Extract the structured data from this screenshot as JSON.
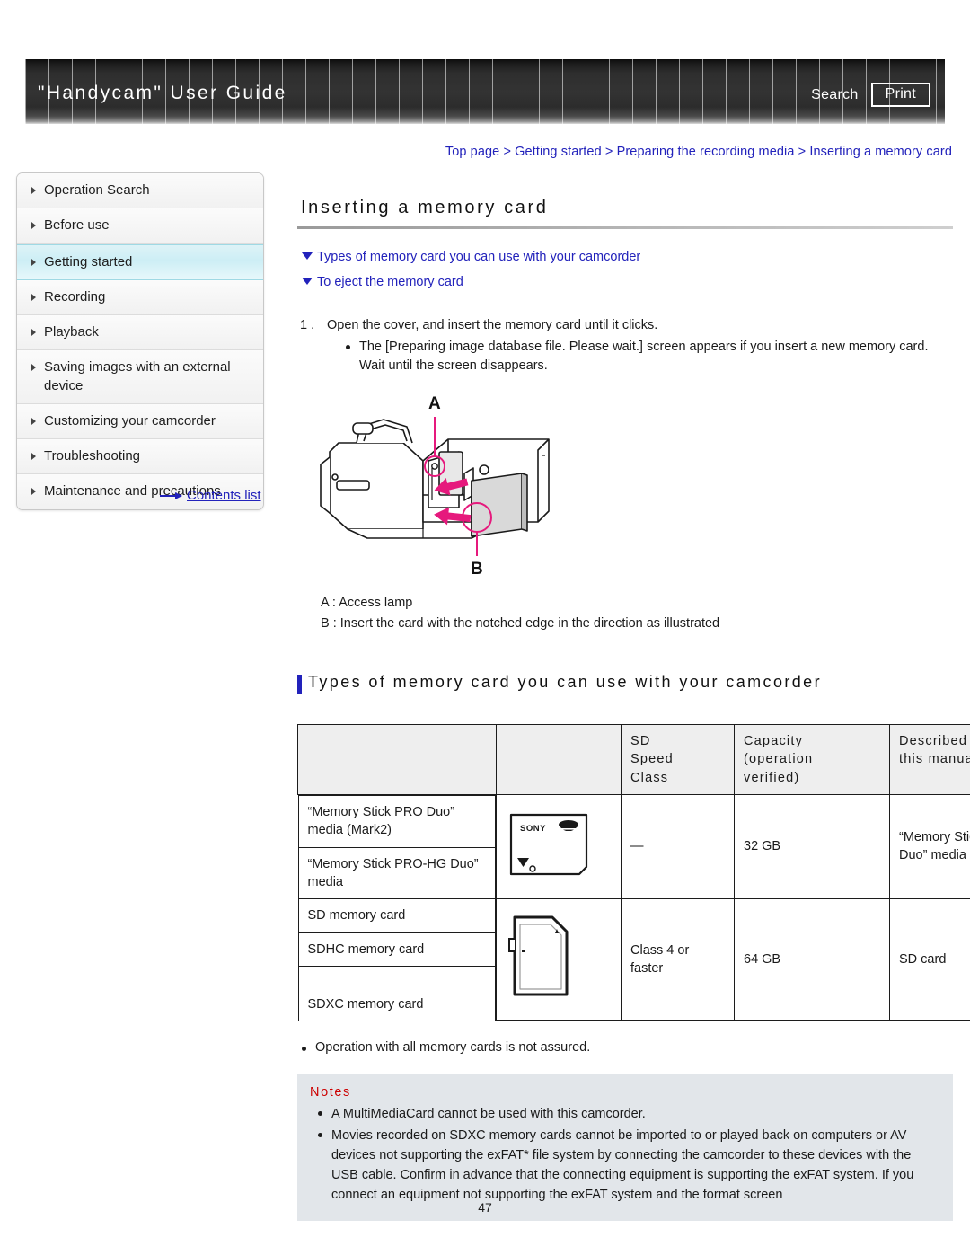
{
  "header": {
    "title": "\"Handycam\" User Guide",
    "search_label": "Search",
    "print_label": "Print"
  },
  "breadcrumb": {
    "text": "Top page > Getting started > Preparing the recording media > Inserting a memory card"
  },
  "sidebar": {
    "items": [
      {
        "label": "Operation Search",
        "active": false
      },
      {
        "label": "Before use",
        "active": false
      },
      {
        "label": "Getting started",
        "active": true
      },
      {
        "label": "Recording",
        "active": false
      },
      {
        "label": "Playback",
        "active": false
      },
      {
        "label": "Saving images with an external device",
        "active": false
      },
      {
        "label": "Customizing your camcorder",
        "active": false
      },
      {
        "label": "Troubleshooting",
        "active": false
      },
      {
        "label": "Maintenance and precautions",
        "active": false
      }
    ],
    "contents_link": "Contents list"
  },
  "main": {
    "page_title": "Inserting a memory card",
    "anchor_links": [
      "Types of memory card you can use with your camcorder",
      "To eject the memory card"
    ],
    "steps": [
      {
        "number": "1 .",
        "text": "Open the cover, and insert the memory card until it clicks.",
        "sub_bullets": [
          "The [Preparing image database file. Please wait.] screen appears if you insert a new memory card. Wait until the screen disappears."
        ]
      }
    ],
    "illustration_callouts": {
      "a": "A",
      "b": "B"
    },
    "caption_lines": [
      "A : Access lamp",
      "B : Insert the card with the notched edge in the direction as illustrated"
    ],
    "section_heading": "Types of memory card you can use with your camcorder",
    "table": {
      "headers": [
        "",
        "",
        "SD\nSpeed\nClass",
        "Capacity\n(operation\nverified)",
        "Described in\nthis manual"
      ],
      "header_cells": {
        "blank1": "",
        "blank2": "",
        "speed": [
          "SD",
          "Speed",
          "Class"
        ],
        "capacity": [
          "Capacity",
          "(operation",
          "verified)"
        ],
        "described": [
          "Described in",
          "this manual"
        ]
      },
      "groups": [
        {
          "names": [
            "“Memory Stick PRO Duo” media (Mark2)",
            "“Memory Stick PRO-HG Duo” media"
          ],
          "card_image": "memory-stick-pro-duo-image",
          "card_brand": "SONY",
          "speed_class": "—",
          "capacity": "32 GB",
          "described": "“Memory Stick PRO Duo” media"
        },
        {
          "names": [
            "SD memory card",
            "SDHC memory card",
            "SDXC memory card"
          ],
          "card_image": "sd-card-image",
          "card_brand": "",
          "speed_class": "Class 4 or faster",
          "capacity": "64 GB",
          "described": "SD card"
        }
      ]
    },
    "after_table_note": "Operation with all memory cards is not assured.",
    "notes": {
      "title": "Notes",
      "items": [
        "A MultiMediaCard cannot be used with this camcorder.",
        "Movies recorded on SDXC memory cards cannot be imported to or played back on computers or AV devices not supporting the exFAT* file system by connecting the camcorder to these devices with the USB cable. Confirm in advance that the connecting equipment is supporting the exFAT system. If you connect an equipment not supporting the exFAT system and the format screen"
      ]
    }
  },
  "page_number": "47",
  "colors": {
    "link": "#2222bb",
    "accent_bar": "#2222bb",
    "notes_title": "#cc0000",
    "notes_bg": "#e2e6ea",
    "active_nav": "#cdeef5",
    "illustration_accent": "#e6197d"
  }
}
